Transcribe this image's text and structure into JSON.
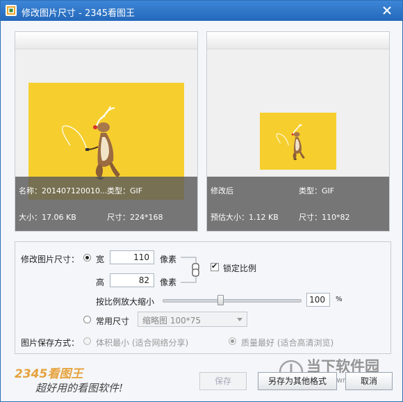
{
  "window": {
    "title": "修改图片尺寸 - 2345看图王"
  },
  "original_panel": {
    "name_label": "名称：201407120010...",
    "type_label": "类型：GIF",
    "size_label": "大小：17.06 KB",
    "dimensions_label": "尺寸：224*168"
  },
  "preview_panel": {
    "status_label": "修改后",
    "type_label": "类型：GIF",
    "estimated_size_label": "预估大小：1.12 KB",
    "dimensions_label": "尺寸：110*82"
  },
  "resize": {
    "section_label": "修改图片尺寸：",
    "width_label": "宽",
    "width_value": "110",
    "width_unit": "像素",
    "height_label": "高",
    "height_value": "82",
    "height_unit": "像素",
    "lock_ratio_label": "锁定比例",
    "lock_ratio_checked": true,
    "scale_label": "按比例放大缩小",
    "scale_value": "100",
    "scale_unit": "%",
    "scale_level_fraction": 0.42,
    "common_size_label": "常用尺寸",
    "common_size_selected": "缩略图 100*75"
  },
  "save_mode": {
    "label": "图片保存方式：",
    "option_small": "体积最小 (适合网络分享)",
    "option_quality": "质量最好 (适合高清浏览)"
  },
  "buttons": {
    "save": "保存",
    "save_as": "另存为其他格式",
    "cancel": "取消"
  },
  "branding": {
    "logo": "2345看图王",
    "tagline": "超好用的看图软件!"
  },
  "watermark": {
    "text": "当下软件园",
    "url": "www.downxia.com"
  },
  "colors": {
    "titlebar": "#2f76c8",
    "image_background": "#f6cf2f",
    "info_overlay": "#5a5a5a"
  }
}
